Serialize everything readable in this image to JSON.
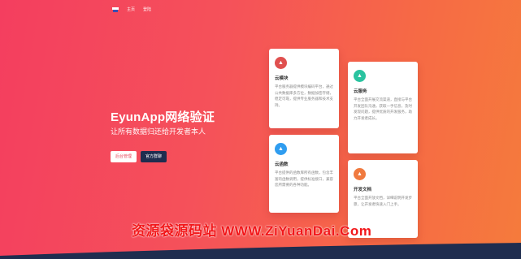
{
  "nav": {
    "links": [
      "主页",
      "登陆"
    ]
  },
  "hero": {
    "title": "EyunApp网络验证",
    "subtitle": "让所有数据归还给开发者本人"
  },
  "buttons": {
    "primary": "后台管理",
    "secondary": "官方群聊"
  },
  "cards": [
    {
      "title": "云模块",
      "desc": "平台服务器提供模块编码平台，通过公共数据库多方位，数据加密存储，稳定可靠，提供专业服务器和技术支持。",
      "icon_color": "#e0504f",
      "icon": "thumb-icon"
    },
    {
      "title": "云服务",
      "desc": "平台全面开展交流渠道，直接与平台开发团队沟通，获取一手信息，及时发现问题，提供优质的开发服务，助力开发者成长。",
      "icon_color": "#2ac3a0",
      "icon": "thumb-icon"
    },
    {
      "title": "云函数",
      "desc": "平台提供的函数库所有函数，包含丰富的函数调用，提供标准接口，兼容您所需要的各种功能。",
      "icon_color": "#2f9df0",
      "icon": "thumb-icon"
    },
    {
      "title": "开发文档",
      "desc": "平台全面开放文档，详细说明开发步骤，让开发者快速入门上手。",
      "icon_color": "#f07a3f",
      "icon": "thumb-icon"
    }
  ],
  "watermark": "资源袋源码站  WWW.ZiYuanDai.Com",
  "colors": {
    "bottom_band": "#1f2d4f",
    "accent": "#e9465a"
  }
}
